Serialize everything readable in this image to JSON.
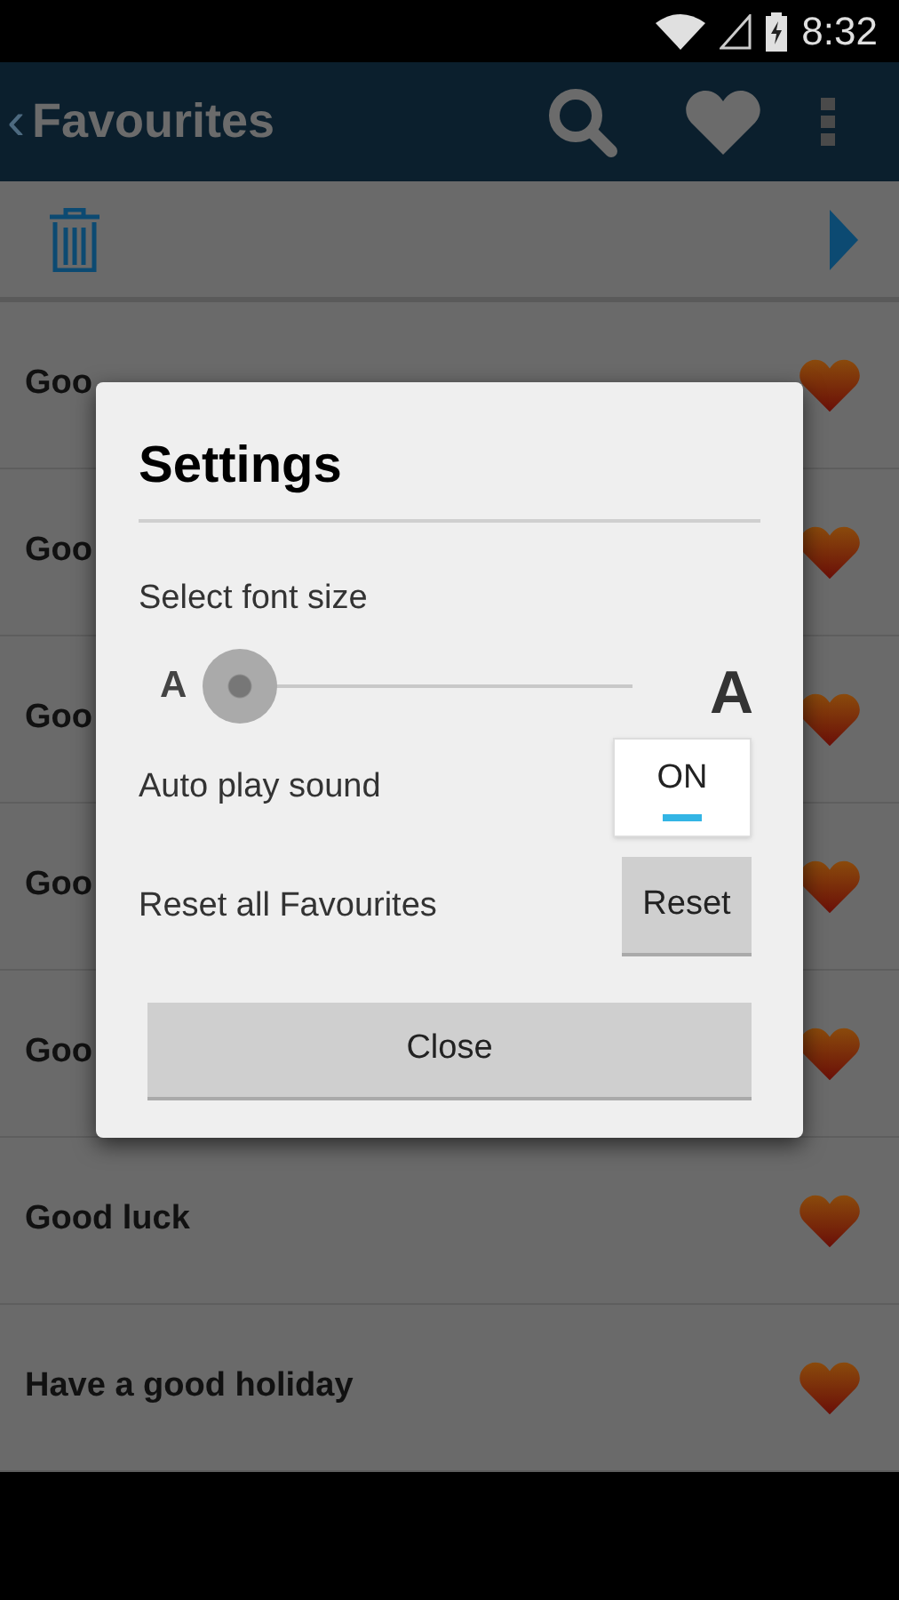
{
  "status_bar": {
    "time": "8:32"
  },
  "app_bar": {
    "back": "‹",
    "title": "Favourites"
  },
  "list": [
    {
      "text": "Goo",
      "favourite": true
    },
    {
      "text": "Goo",
      "favourite": true
    },
    {
      "text": "Goo",
      "favourite": true
    },
    {
      "text": "Goo",
      "favourite": true
    },
    {
      "text": "Goo",
      "favourite": true
    },
    {
      "text": "Good luck",
      "favourite": true
    },
    {
      "text": "Have a good holiday",
      "favourite": true
    }
  ],
  "dialog": {
    "title": "Settings",
    "font_size": {
      "label": "Select font size",
      "small": "A",
      "large": "A",
      "level": 0
    },
    "auto_play": {
      "label": "Auto play sound",
      "toggle": "ON",
      "on": true
    },
    "reset": {
      "label": "Reset all Favourites",
      "button": "Reset"
    },
    "close": "Close"
  }
}
